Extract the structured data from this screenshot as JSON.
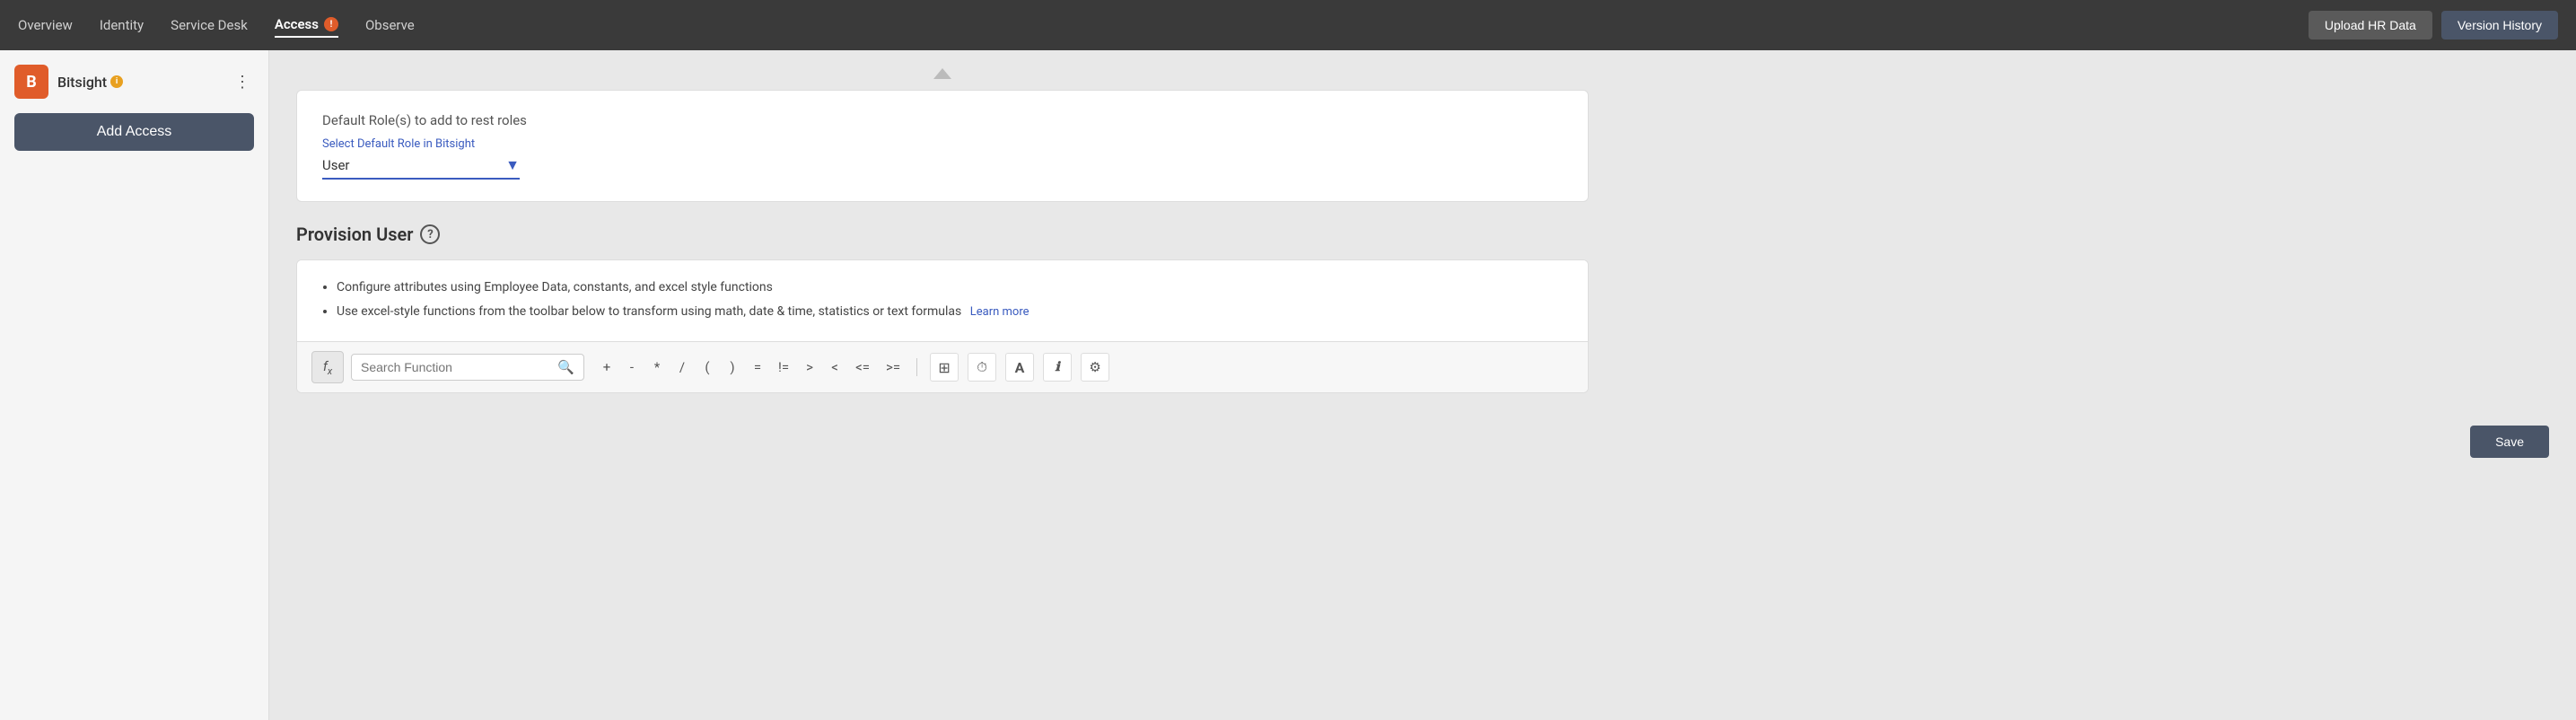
{
  "nav": {
    "items": [
      {
        "label": "Overview",
        "active": false
      },
      {
        "label": "Identity",
        "active": false
      },
      {
        "label": "Service Desk",
        "active": false
      },
      {
        "label": "Access",
        "active": true,
        "badge": "!"
      },
      {
        "label": "Observe",
        "active": false
      }
    ],
    "upload_hr_label": "Upload HR Data",
    "version_history_label": "Version History"
  },
  "sidebar": {
    "logo_letter": "B",
    "logo_name": "Bitsight",
    "add_access_label": "Add Access"
  },
  "default_role": {
    "section_title": "Default Role(s) to add to rest roles",
    "select_label": "Select Default Role in Bitsight",
    "selected_value": "User"
  },
  "provision_user": {
    "title": "Provision User",
    "help_tooltip": "?",
    "bullet1": "Configure attributes using Employee Data, constants, and excel style functions",
    "bullet2": "Use excel-style functions from the toolbar below to transform using math, date & time, statistics or text formulas",
    "learn_more_label": "Learn more",
    "search_placeholder": "Search Function",
    "toolbar_ops": [
      "+",
      "-",
      "*",
      "/",
      "(",
      ")",
      "=",
      "!=",
      ">",
      "<",
      "<=",
      ">="
    ]
  },
  "icons": {
    "fx": "fx",
    "search": "🔍",
    "grid": "⊞",
    "clock": "⏱",
    "font": "A",
    "info_cursor": "Ⅰ",
    "settings_people": "⚙"
  }
}
